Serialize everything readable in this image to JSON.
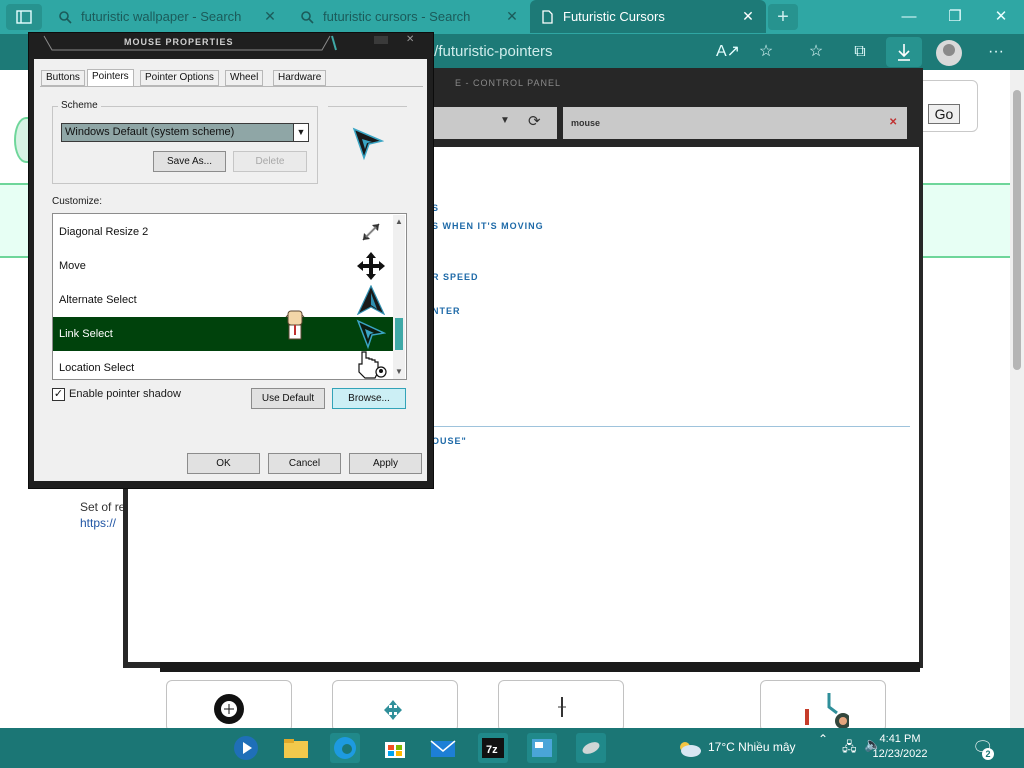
{
  "browser": {
    "tabs": [
      {
        "label": "futuristic wallpaper - Search"
      },
      {
        "label": "futuristic cursors - Search"
      },
      {
        "label": "Futuristic Cursors"
      }
    ],
    "new_tab_glyph": "+",
    "close_glyph": "✕",
    "window_controls": {
      "minimize": "—",
      "maximize": "❐",
      "close": "✕"
    },
    "address_suffix": "t/futuristic-pointers",
    "colors": {
      "chrome": "#2fa7a4",
      "toolbar": "#1d7a77",
      "taskbar": "#1b7675"
    }
  },
  "page": {
    "go_label": "Go",
    "text_line": "Set of re",
    "link_text": "https://",
    "control_panel": {
      "title": "E - CONTROL PANEL",
      "search_text": "mouse",
      "options": [
        "S",
        "S WHEN IT'S MOVING",
        "R SPEED",
        "NTER",
        "OUSE\""
      ]
    }
  },
  "dialog": {
    "title": "MOUSE PROPERTIES",
    "tabs": [
      "Buttons",
      "Pointers",
      "Pointer Options",
      "Wheel",
      "Hardware"
    ],
    "selected_tab": "Pointers",
    "scheme_label": "Scheme",
    "scheme_value": "Windows Default (system scheme)",
    "save_as_label": "Save As...",
    "delete_label": "Delete",
    "customize_label": "Customize:",
    "pointers": [
      {
        "name": "Diagonal Resize 2",
        "icon": "diagonal-resize-icon"
      },
      {
        "name": "Move",
        "icon": "move-icon"
      },
      {
        "name": "Alternate Select",
        "icon": "alternate-select-icon"
      },
      {
        "name": "Link Select",
        "icon": "link-select-icon",
        "selected": true
      },
      {
        "name": "Location Select",
        "icon": "location-select-icon"
      }
    ],
    "shadow_label": "Enable pointer shadow",
    "shadow_checked": true,
    "use_default_label": "Use Default",
    "browse_label": "Browse...",
    "ok_label": "OK",
    "cancel_label": "Cancel",
    "apply_label": "Apply",
    "selection_color": "#00420c"
  },
  "taskbar": {
    "weather": "17°C  Nhiều mây",
    "time": "4:41 PM",
    "date": "12/23/2022",
    "notification_count": "2"
  }
}
